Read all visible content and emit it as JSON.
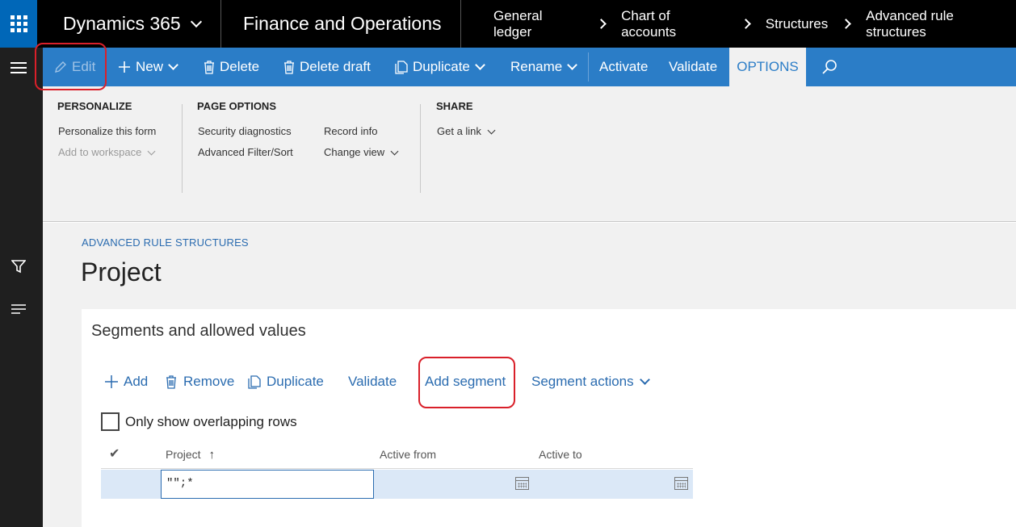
{
  "topbar": {
    "brand": "Dynamics 365",
    "app_name": "Finance and Operations",
    "breadcrumbs": [
      "General ledger",
      "Chart of accounts",
      "Structures",
      "Advanced rule structures"
    ]
  },
  "actions": {
    "edit": "Edit",
    "new": "New",
    "delete": "Delete",
    "delete_draft": "Delete draft",
    "duplicate": "Duplicate",
    "rename": "Rename",
    "activate": "Activate",
    "validate": "Validate",
    "options_tab": "OPTIONS"
  },
  "ribbon": {
    "personalize": {
      "header": "PERSONALIZE",
      "items": [
        "Personalize this form",
        "Add to workspace"
      ]
    },
    "page_options": {
      "header": "PAGE OPTIONS",
      "col1": [
        "Security diagnostics",
        "Advanced Filter/Sort"
      ],
      "col2": [
        "Record info",
        "Change view"
      ]
    },
    "share": {
      "header": "SHARE",
      "items": [
        "Get a link"
      ]
    }
  },
  "page": {
    "breadcrumb": "ADVANCED RULE STRUCTURES",
    "title": "Project"
  },
  "segments": {
    "title": "Segments and allowed values",
    "toolbar": {
      "add": "Add",
      "remove": "Remove",
      "duplicate": "Duplicate",
      "validate": "Validate",
      "add_segment": "Add segment",
      "segment_actions": "Segment actions"
    },
    "overlap_label": "Only show overlapping rows",
    "columns": {
      "check": "✔",
      "project": "Project",
      "sort_indicator": "↑",
      "active_from": "Active from",
      "active_to": "Active to"
    },
    "rows": [
      {
        "project": "\"\";*",
        "active_from": "",
        "active_to": ""
      }
    ]
  },
  "colors": {
    "accent": "#2b7dc7",
    "waffle": "#0067b8",
    "highlight": "#d9202a"
  }
}
